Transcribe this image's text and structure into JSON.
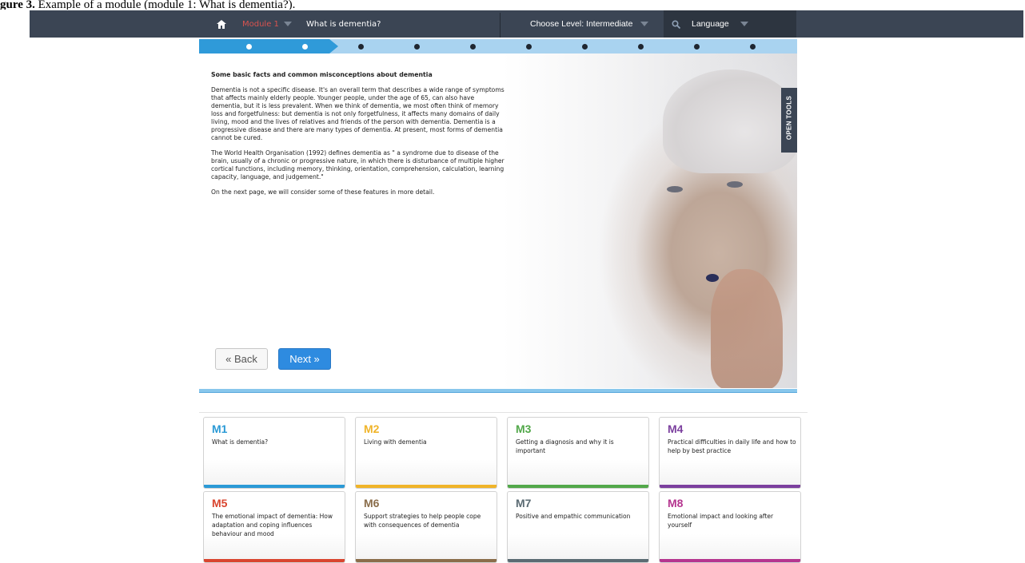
{
  "caption": {
    "prefix": "gure 3.",
    "text": " Example of a module (module 1: What is dementia?)."
  },
  "topbar": {
    "module_label": "Module 1",
    "page_title": "What is dementia?",
    "level_label": "Choose Level: Intermediate",
    "language_label": "Language"
  },
  "progress": {
    "total_steps": 10,
    "completed_steps": 2
  },
  "content": {
    "heading": "Some basic facts and common misconceptions about dementia",
    "p1": "Dementia is not a specific disease. It's an overall term that describes a wide range of symptoms that affects mainly elderly people. Younger people, under the age of 65, can also have dementia, but it is less prevalent. When we think of dementia, we most often think of memory loss and forgetfulness: but dementia is not only forgetfulness, it affects many domains of daily living, mood and the lives of relatives and friends of the person with dementia. Dementia is a progressive disease and there are many types of dementia. At present, most forms of dementia cannot be cured.",
    "p2": "The World Health Organisation (1992) defines dementia as \" a syndrome due to disease of the brain, usually of a chronic or progressive nature, in which there is disturbance of multiple higher cortical functions, including memory, thinking, orientation, comprehension, calculation, learning capacity, language, and judgement.\"",
    "p3": "On the next page, we will consider some of these features in more detail."
  },
  "buttons": {
    "back": "« Back",
    "next": "Next »"
  },
  "tools_label": "OPEN TOOLS",
  "modules": [
    {
      "code": "M1",
      "label": "What is dementia?",
      "color": "#2b9ad6"
    },
    {
      "code": "M2",
      "label": "Living with dementia",
      "color": "#f0b429"
    },
    {
      "code": "M3",
      "label": "Getting a diagnosis and why it is important",
      "color": "#52a84a"
    },
    {
      "code": "M4",
      "label": "Practical difficulties in daily life and how to help by best practice",
      "color": "#7b3f9e"
    },
    {
      "code": "M5",
      "label": "The emotional impact of dementia: How adaptation and coping influences behaviour and mood",
      "color": "#d9452f"
    },
    {
      "code": "M6",
      "label": "Support strategies to help people cope with consequences of dementia",
      "color": "#8a6d4a"
    },
    {
      "code": "M7",
      "label": "Positive and empathic communication",
      "color": "#5b6b73"
    },
    {
      "code": "M8",
      "label": "Emotional impact and looking after yourself",
      "color": "#b5358f"
    }
  ]
}
